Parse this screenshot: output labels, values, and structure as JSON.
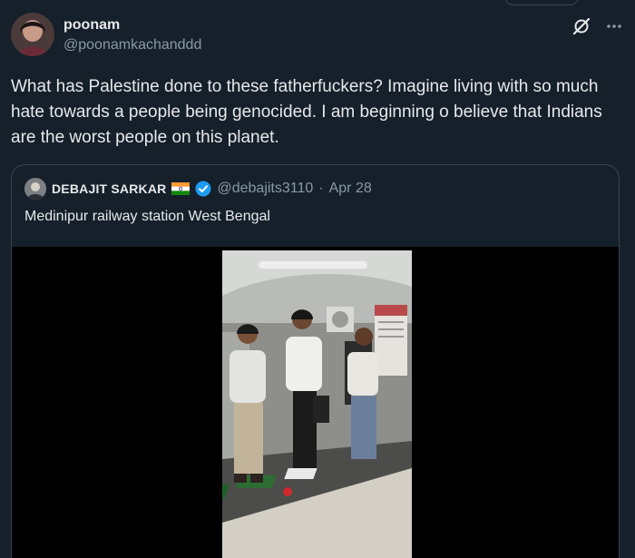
{
  "tweet": {
    "author": {
      "display_name": "poonam",
      "handle": "@poonamkachanddd"
    },
    "text": "What has Palestine done to these fatherfuckers? Imagine living with so much hate towards a people being genocided. I am beginning o believe that Indians are the worst people on this planet."
  },
  "quote": {
    "author": {
      "display_name": "DEBAJIT SARKAR",
      "handle": "@debajits3110",
      "separator": "·",
      "date": "Apr 28"
    },
    "text": "Medinipur railway station West Bengal"
  },
  "icons": {
    "grok": "grok-icon",
    "more": "more-icon",
    "verified": "verified-badge-icon",
    "flag": "india-flag-icon"
  },
  "colors": {
    "background": "#15202b",
    "text_primary": "#e7e9ea",
    "text_secondary": "#8b98a5",
    "border": "#38444d",
    "verified_blue": "#1d9bf0"
  }
}
